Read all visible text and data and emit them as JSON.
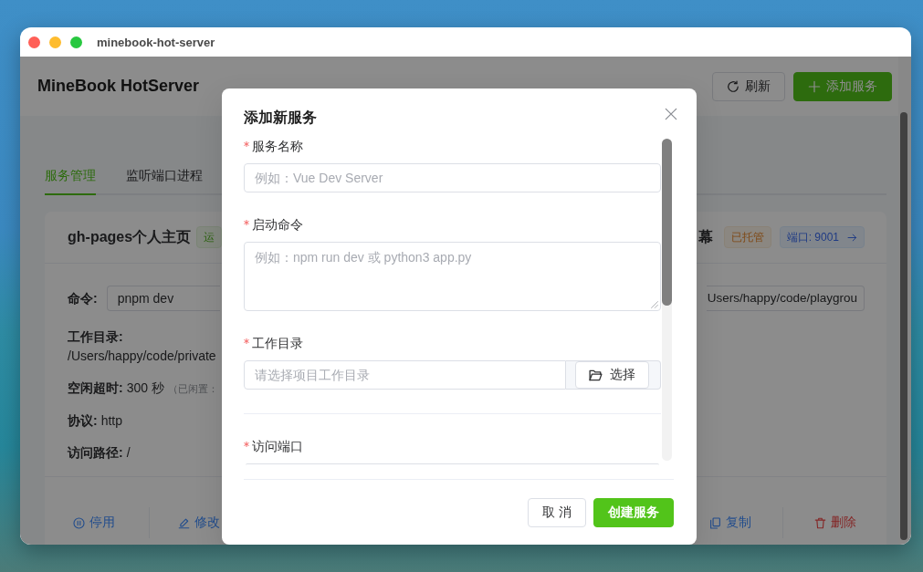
{
  "window": {
    "title": "minebook-hot-server"
  },
  "header": {
    "title": "MineBook HotServer",
    "buttons": [
      {
        "label": "刷新",
        "kind": "refresh"
      },
      {
        "label": "添加服务",
        "kind": "add"
      }
    ]
  },
  "tabs": [
    {
      "label": "服务管理",
      "selected": true
    },
    {
      "label": "监听端口进程",
      "selected": false
    }
  ],
  "service_cards": [
    {
      "name": "gh-pages个人主页",
      "tags": [
        {
          "label": "运",
          "kind": "success"
        }
      ],
      "command": {
        "label": "命令:",
        "value": "pnpm dev"
      },
      "details": [
        {
          "kind": "stacked",
          "label": "工作目录:",
          "value": "/Users/happy/code/private"
        },
        {
          "kind": "inline",
          "label": "空闲超时:",
          "value": "300 秒",
          "note": "（已闲置："
        },
        {
          "kind": "inline",
          "label": "协议:",
          "value": "http"
        },
        {
          "kind": "inline",
          "label": "访问路径:",
          "value": "/"
        }
      ],
      "actions": [
        {
          "label": "停用",
          "kind": "pause"
        },
        {
          "label": "修改",
          "kind": "edit"
        }
      ]
    },
    {
      "name": "幕",
      "tags": [
        {
          "label": "已托管",
          "kind": "warning"
        },
        {
          "label": "端口: 9001",
          "kind": "link"
        }
      ],
      "command": {
        "value": "Users/happy/code/playgrou"
      },
      "actions": [
        {
          "label": "复制",
          "kind": "copy"
        },
        {
          "label": "删除",
          "kind": "delete"
        }
      ]
    }
  ],
  "dialog": {
    "title": "添加新服务",
    "fields": [
      {
        "kind": "input",
        "label": "服务名称",
        "required": true,
        "placeholder": "例如：Vue Dev Server"
      },
      {
        "kind": "textarea",
        "label": "启动命令",
        "required": true,
        "placeholder": "例如：npm run dev 或 python3 app.py"
      },
      {
        "kind": "picker",
        "label": "工作目录",
        "required": true,
        "placeholder": "请选择项目工作目录",
        "button": "选择"
      },
      {
        "kind": "divider"
      },
      {
        "kind": "partial",
        "label": "访问端口",
        "required": true
      }
    ],
    "buttons": [
      {
        "label": "取 消",
        "kind": "default"
      },
      {
        "label": "创建服务",
        "kind": "primary"
      }
    ]
  }
}
